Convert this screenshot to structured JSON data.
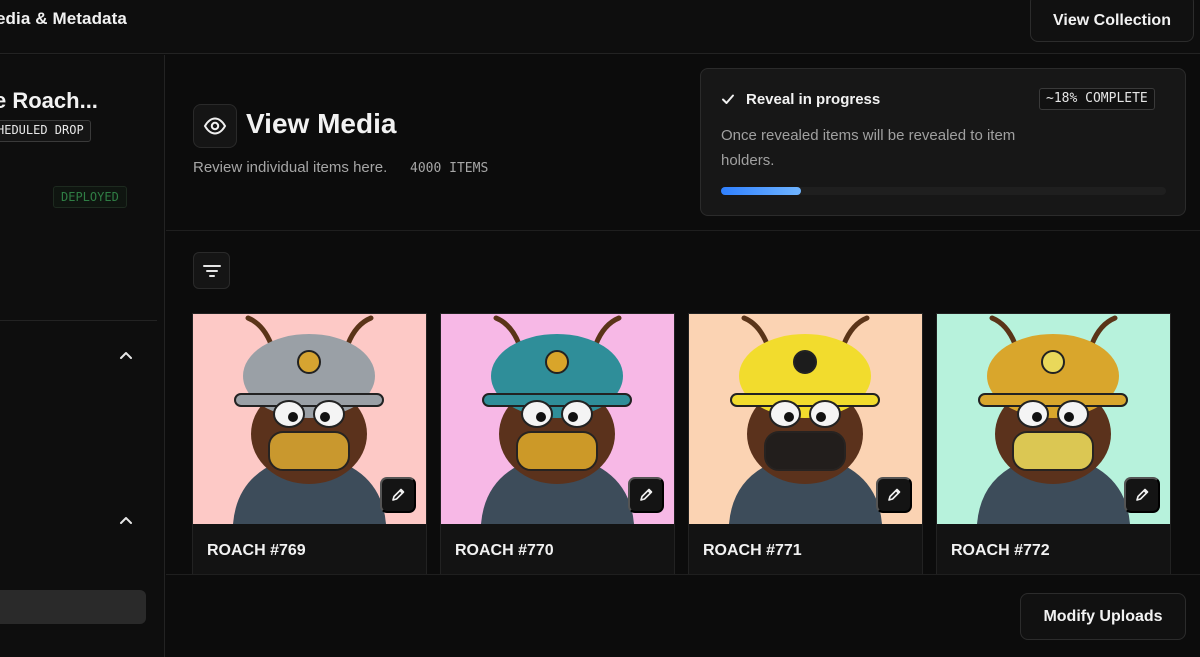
{
  "topbar": {
    "title": "edia & Metadata",
    "view_collection_label": "View Collection"
  },
  "sidebar": {
    "drop_name": "e Roach...",
    "drop_status": "HEDULED DROP",
    "deploy_status": "DEPLOYED",
    "sections": [
      {
        "icon": "chevron-up-icon"
      },
      {
        "icon": "chevron-up-icon"
      }
    ]
  },
  "header": {
    "title": "View Media",
    "title_icon": "eye-icon",
    "subtitle": "Review individual items here.",
    "item_count": "4000 ITEMS"
  },
  "reveal": {
    "title": "Reveal in progress",
    "percent_label": "~18% COMPLETE",
    "progress": 0.18,
    "description": "Once revealed items will be revealed to item holders."
  },
  "toolbar": {
    "filter_icon": "filter-icon"
  },
  "items": [
    {
      "name": "ROACH #769",
      "bg": "#fdc9c6",
      "helmet": "#9aa0a6",
      "accent": "#d6a431"
    },
    {
      "name": "ROACH #770",
      "bg": "#f7b8e6",
      "helmet": "#2f8e99",
      "accent": "#d9a52a"
    },
    {
      "name": "ROACH #771",
      "bg": "#fbd3b3",
      "helmet": "#f2dc2d",
      "accent": "#1c1c1c"
    },
    {
      "name": "ROACH #772",
      "bg": "#b7f2dc",
      "helmet": "#d9a62c",
      "accent": "#e9d85a"
    }
  ],
  "footer": {
    "modify_label": "Modify Uploads"
  },
  "colors": {
    "accent_blue": "#2f80ff",
    "deployed_green": "#2f7d44",
    "background": "#0c0c0c"
  }
}
